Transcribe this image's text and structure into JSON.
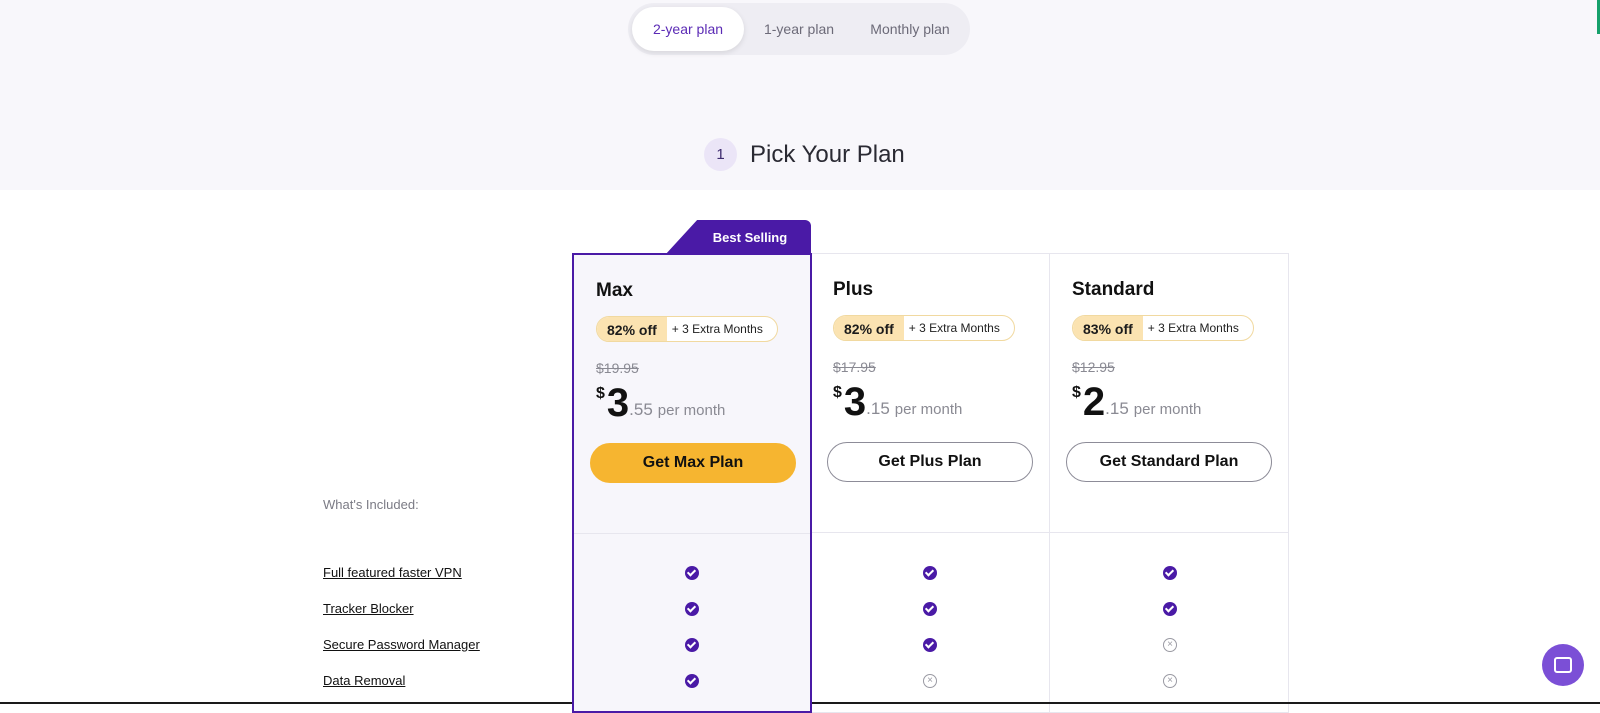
{
  "tabs": [
    "2-year plan",
    "1-year plan",
    "Monthly plan"
  ],
  "step": {
    "number": "1",
    "title": "Pick Your Plan"
  },
  "ribbon": "Best Selling",
  "plans": [
    {
      "name": "Max",
      "discount": "82% off",
      "extra": "+ 3 Extra Months",
      "old_price": "$19.95",
      "currency": "$",
      "whole": "3",
      "cents": ".55",
      "per": "per month",
      "cta": "Get Max Plan"
    },
    {
      "name": "Plus",
      "discount": "82% off",
      "extra": "+ 3 Extra Months",
      "old_price": "$17.95",
      "currency": "$",
      "whole": "3",
      "cents": ".15",
      "per": "per month",
      "cta": "Get Plus Plan"
    },
    {
      "name": "Standard",
      "discount": "83% off",
      "extra": "+ 3 Extra Months",
      "old_price": "$12.95",
      "currency": "$",
      "whole": "2",
      "cents": ".15",
      "per": "per month",
      "cta": "Get Standard Plan"
    }
  ],
  "included_label": "What's Included:",
  "features": [
    {
      "name": "Full featured faster VPN",
      "max": true,
      "plus": true,
      "standard": true
    },
    {
      "name": "Tracker Blocker",
      "max": true,
      "plus": true,
      "standard": true
    },
    {
      "name": "Secure Password Manager",
      "max": true,
      "plus": true,
      "standard": false
    },
    {
      "name": "Data Removal",
      "max": true,
      "plus": false,
      "standard": false
    }
  ],
  "colors": {
    "accent": "#4a1aa6",
    "cta_primary": "#f6b530",
    "chat": "#7b4fd6"
  },
  "icons": {
    "included": "check-circle-icon",
    "excluded": "x-circle-icon",
    "chat": "chat-icon"
  }
}
